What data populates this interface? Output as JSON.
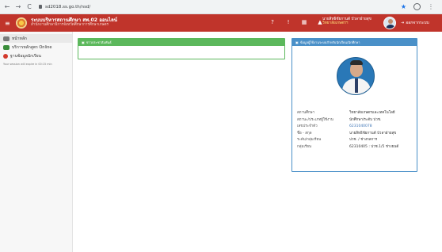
{
  "browser": {
    "back": "←",
    "forward": "→",
    "reload": "C",
    "url": "sd2018.ss.go.th/nsd/",
    "star": "★",
    "menu": "⋮"
  },
  "header": {
    "menu_icon": "≡",
    "title": "ระบบบริหารสถานศึกษา สพ.02 ออนไลน์",
    "subtitle": "สำนักงานศึกษาธิการจังหวัดศึกษาการศึกษาเกษตร",
    "icons": [
      "help-icon",
      "alert-icon",
      "calendar-icon",
      "bell-icon"
    ],
    "user_line1": "นายสิทธิชัยกานต์ บัวลาฝ่ายสุข",
    "user_line2": "วิทยาลัยเกษตรฯ",
    "logout": "ออกจากระบบ"
  },
  "sidebar": {
    "items": [
      {
        "label": "หน้าหลัก",
        "color": "#7a7a7a"
      },
      {
        "label": "บริการหลักสูตร Online",
        "color": "#3a8d3a"
      },
      {
        "label": "ฐานข้อมูลนักเรียน",
        "color": "#d33a2c"
      }
    ],
    "note": "Your session will expire in 00:15 min"
  },
  "main": {
    "left_card_title": "ข่าวประชาสัมพันธ์",
    "right_card_title": "ข้อมูลผู้ใช้งานระบบสำหรับนักเรียน/นักศึกษา",
    "info": [
      {
        "label": "สถานศึกษา",
        "value": "วิทยาลัยเกษตรและเทคโนโลยี",
        "link": false
      },
      {
        "label": "สถานะ/ประเภทผู้ใช้งาน",
        "value": "นักศึกษา/ระดับ ปวช.",
        "link": false
      },
      {
        "label": "เลขประจำตัว",
        "value": "6231040078",
        "link": true
      },
      {
        "label": "ชื่อ - สกุล",
        "value": "นายสิทธิชัยกานต์ บัวลาฝ่ายสุข",
        "link": false
      },
      {
        "label": "ระดับ/กลุ่มเรียน",
        "value": "ปวช. / ช่างกลการ",
        "link": false
      },
      {
        "label": "กลุ่มเรียน",
        "value": "62310405 : ปวช.1/5 ช่างยนต์",
        "link": false
      }
    ]
  },
  "colors": {
    "header": "#c0342b",
    "green": "#5cb85c",
    "blue": "#4a90c8"
  }
}
